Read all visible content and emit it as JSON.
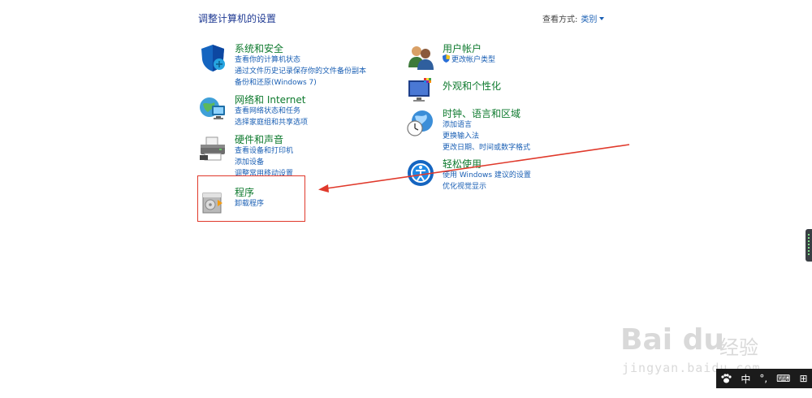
{
  "header": {
    "title": "调整计算机的设置",
    "view_by_label": "查看方式:",
    "view_by_value": "类别"
  },
  "categories": {
    "security": {
      "title": "系统和安全",
      "links": [
        "查看你的计算机状态",
        "通过文件历史记录保存你的文件备份副本",
        "备份和还原(Windows 7)"
      ]
    },
    "network": {
      "title": "网络和 Internet",
      "links": [
        "查看网络状态和任务",
        "选择家庭组和共享选项"
      ]
    },
    "hardware": {
      "title": "硬件和声音",
      "links": [
        "查看设备和打印机",
        "添加设备",
        "调整常用移动设置"
      ]
    },
    "programs": {
      "title": "程序",
      "links": [
        "卸载程序"
      ]
    },
    "users": {
      "title": "用户帐户",
      "links": [
        "更改帐户类型"
      ]
    },
    "appearance": {
      "title": "外观和个性化",
      "links": []
    },
    "clock": {
      "title": "时钟、语言和区域",
      "links": [
        "添加语言",
        "更换输入法",
        "更改日期、时间或数字格式"
      ]
    },
    "ease": {
      "title": "轻松使用",
      "links": [
        "使用 Windows 建议的设置",
        "优化视觉显示"
      ]
    }
  },
  "watermark": {
    "brand": "Bai du",
    "brand_cn": "经验",
    "url": "jingyan.baidu.com"
  },
  "ime_bar": {
    "items": [
      "中",
      "°,",
      "⌨",
      "⊞"
    ]
  },
  "colors": {
    "category_title": "#0e7a2e",
    "link": "#1a5fb4",
    "highlight": "#e0392b"
  }
}
